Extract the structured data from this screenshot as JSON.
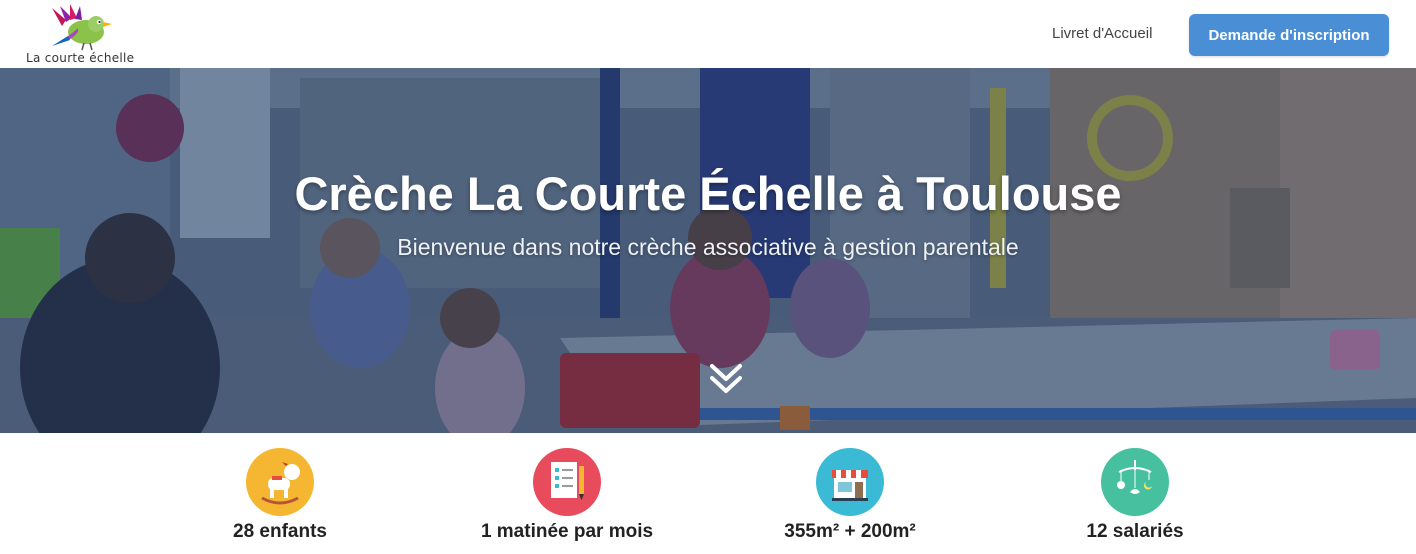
{
  "header": {
    "logo_text": "La courte échelle",
    "nav_link": "Livret d'Accueil",
    "cta_button": "Demande d'inscription"
  },
  "hero": {
    "title": "Crèche La Courte Échelle à Toulouse",
    "subtitle": "Bienvenue dans notre crèche associative à gestion parentale",
    "scroll_icon": "double-chevron-down-icon"
  },
  "stats": [
    {
      "label": "28 enfants",
      "icon": "rocking-horse-icon",
      "color": "#f5b731"
    },
    {
      "label": "1 matinée par mois",
      "icon": "checklist-icon",
      "color": "#e84c5c"
    },
    {
      "label": "355m² + 200m²",
      "icon": "storefront-icon",
      "color": "#3bbad6"
    },
    {
      "label": "12 salariés",
      "icon": "baby-mobile-icon",
      "color": "#47c0a0"
    }
  ],
  "colors": {
    "accent": "#4a8fd6",
    "hero_overlay": "#1c345c"
  }
}
